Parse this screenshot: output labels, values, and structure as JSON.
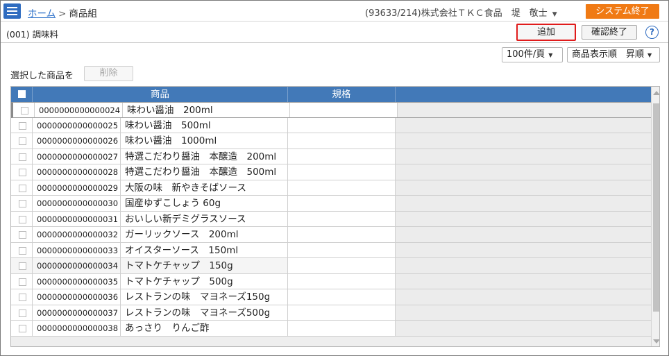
{
  "header": {
    "breadcrumb_home": "ホーム",
    "breadcrumb_sep": ">",
    "breadcrumb_current": "商品組",
    "user_info": "(93633/214)株式会社ＴＫＣ食品　堤　敬士",
    "system_exit_label": "システム終了"
  },
  "subheader": {
    "group_name": "(001) 調味料",
    "add_label": "追加",
    "confirm_label": "確認終了",
    "help_label": "?"
  },
  "options": {
    "per_page": "100件/頁",
    "sort": "商品表示順　昇順"
  },
  "selection": {
    "label": "選択した商品を",
    "delete_label": "削除"
  },
  "table": {
    "headers": {
      "product": "商品",
      "spec": "規格"
    },
    "rows": [
      {
        "code": "0000000000000024",
        "name": "味わい醤油　200ml"
      },
      {
        "code": "0000000000000025",
        "name": "味わい醤油　500ml"
      },
      {
        "code": "0000000000000026",
        "name": "味わい醤油　1000ml"
      },
      {
        "code": "0000000000000027",
        "name": "特選こだわり醤油　本醸造　200ml"
      },
      {
        "code": "0000000000000028",
        "name": "特選こだわり醤油　本醸造　500ml"
      },
      {
        "code": "0000000000000029",
        "name": "大阪の味　新やきそばソース"
      },
      {
        "code": "0000000000000030",
        "name": "国産ゆずこしょう 60g"
      },
      {
        "code": "0000000000000031",
        "name": "おいしい新デミグラスソース"
      },
      {
        "code": "0000000000000032",
        "name": "ガーリックソース　200ml"
      },
      {
        "code": "0000000000000033",
        "name": "オイスターソース　150ml"
      },
      {
        "code": "0000000000000034",
        "name": "トマトケチャップ　150g"
      },
      {
        "code": "0000000000000035",
        "name": "トマトケチャップ　500g"
      },
      {
        "code": "0000000000000036",
        "name": "レストランの味　マヨネーズ150g"
      },
      {
        "code": "0000000000000037",
        "name": "レストランの味　マヨネーズ500g"
      },
      {
        "code": "0000000000000038",
        "name": "あっさり　りんご酢"
      }
    ]
  }
}
